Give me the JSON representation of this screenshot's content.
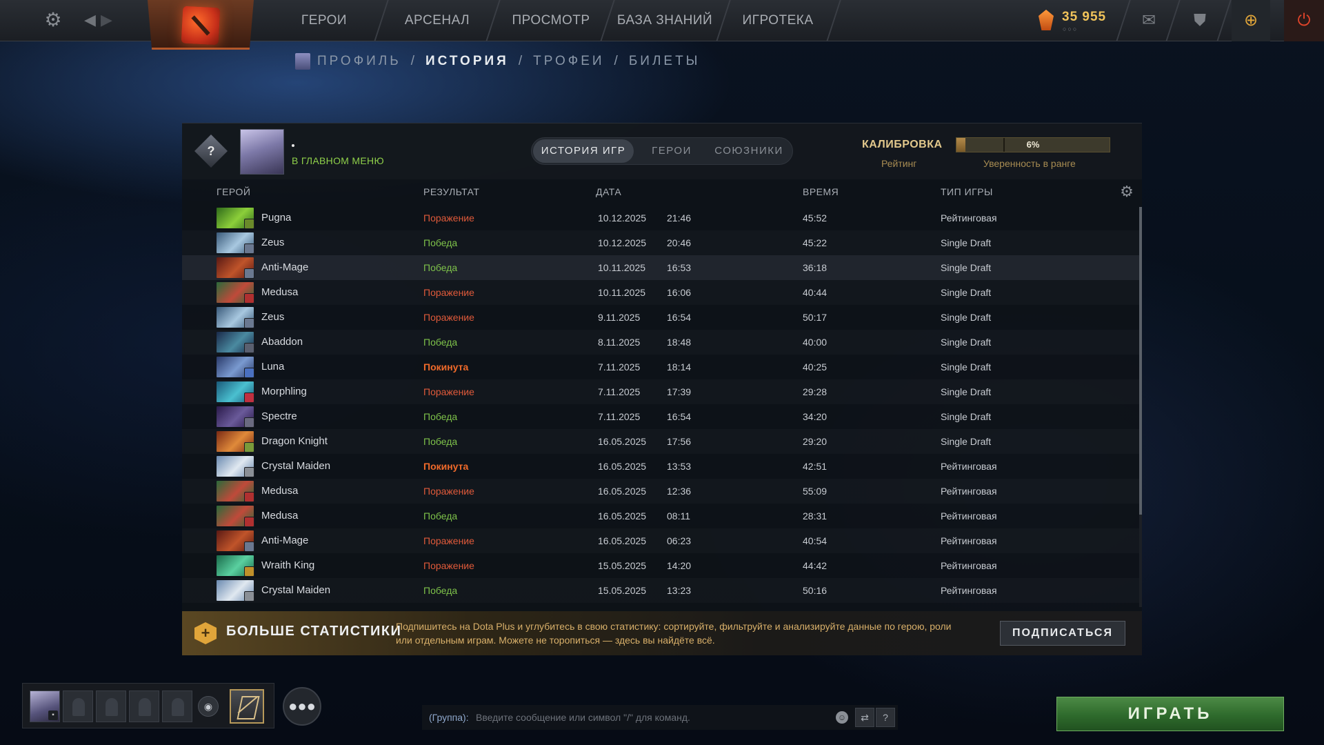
{
  "topbar": {
    "nav": [
      "ГЕРОИ",
      "АРСЕНАЛ",
      "ПРОСМОТР",
      "БАЗА ЗНАНИЙ",
      "ИГРОТЕКА"
    ],
    "shards": "35 955",
    "shards_dots": "○○○"
  },
  "breadcrumb": {
    "items": [
      "ПРОФИЛЬ",
      "ИСТОРИЯ",
      "ТРОФЕИ",
      "БИЛЕТЫ"
    ],
    "separator": "/"
  },
  "profile": {
    "rank_symbol": "?",
    "player_name": "•",
    "status": "В ГЛАВНОМ МЕНЮ"
  },
  "tabs": [
    "ИСТОРИЯ ИГР",
    "ГЕРОИ",
    "СОЮЗНИКИ"
  ],
  "calibration": {
    "title": "КАЛИБРОВКА",
    "rating_label": "Рейтинг",
    "confidence_pct": "6%",
    "confidence_value": 0.06,
    "confidence_label": "Уверенность в ранге"
  },
  "table": {
    "headers": {
      "hero": "ГЕРОЙ",
      "result": "РЕЗУЛЬТАТ",
      "date": "ДАТА",
      "duration": "ВРЕМЯ",
      "type": "ТИП ИГРЫ"
    },
    "rows": [
      {
        "hero": "Pugna",
        "result": "Поражение",
        "result_kind": "loss",
        "date": "10.12.2025",
        "time": "21:46",
        "duration": "45:52",
        "type": "Рейтинговая",
        "colors": [
          "#2f6a1a",
          "#8ccf3a"
        ],
        "badge": "#6a8a2a"
      },
      {
        "hero": "Zeus",
        "result": "Победа",
        "result_kind": "win",
        "date": "10.12.2025",
        "time": "20:46",
        "duration": "45:22",
        "type": "Single Draft",
        "colors": [
          "#3a5a7a",
          "#a8c8e0"
        ],
        "badge": "#6a7890"
      },
      {
        "hero": "Anti-Mage",
        "result": "Победа",
        "result_kind": "win",
        "date": "10.11.2025",
        "time": "16:53",
        "duration": "36:18",
        "type": "Single Draft",
        "colors": [
          "#5a1a14",
          "#c0542a"
        ],
        "badge": "#6a7890"
      },
      {
        "hero": "Medusa",
        "result": "Поражение",
        "result_kind": "loss",
        "date": "10.11.2025",
        "time": "16:06",
        "duration": "40:44",
        "type": "Single Draft",
        "colors": [
          "#2a6a3a",
          "#c04a3a"
        ],
        "badge": "#b03030"
      },
      {
        "hero": "Zeus",
        "result": "Поражение",
        "result_kind": "loss",
        "date": "9.11.2025",
        "time": "16:54",
        "duration": "50:17",
        "type": "Single Draft",
        "colors": [
          "#3a5a7a",
          "#a8c8e0"
        ],
        "badge": "#6a7890"
      },
      {
        "hero": "Abaddon",
        "result": "Победа",
        "result_kind": "win",
        "date": "8.11.2025",
        "time": "18:48",
        "duration": "40:00",
        "type": "Single Draft",
        "colors": [
          "#1a2a4a",
          "#4a8aa0"
        ],
        "badge": "#5a6070"
      },
      {
        "hero": "Luna",
        "result": "Покинута",
        "result_kind": "abandon",
        "date": "7.11.2025",
        "time": "18:14",
        "duration": "40:25",
        "type": "Single Draft",
        "colors": [
          "#2a3a6a",
          "#7a9ad0"
        ],
        "badge": "#4a70c0"
      },
      {
        "hero": "Morphling",
        "result": "Поражение",
        "result_kind": "loss",
        "date": "7.11.2025",
        "time": "17:39",
        "duration": "29:28",
        "type": "Single Draft",
        "colors": [
          "#1a5a7a",
          "#4ac0d0"
        ],
        "badge": "#c03040"
      },
      {
        "hero": "Spectre",
        "result": "Победа",
        "result_kind": "win",
        "date": "7.11.2025",
        "time": "16:54",
        "duration": "34:20",
        "type": "Single Draft",
        "colors": [
          "#2a1a4a",
          "#6a5a9a"
        ],
        "badge": "#6a6a80"
      },
      {
        "hero": "Dragon Knight",
        "result": "Победа",
        "result_kind": "win",
        "date": "16.05.2025",
        "time": "17:56",
        "duration": "29:20",
        "type": "Single Draft",
        "colors": [
          "#7a2a14",
          "#e08a3a"
        ],
        "badge": "#7a9a3a"
      },
      {
        "hero": "Crystal Maiden",
        "result": "Покинута",
        "result_kind": "abandon",
        "date": "16.05.2025",
        "time": "13:53",
        "duration": "42:51",
        "type": "Рейтинговая",
        "colors": [
          "#6a8ab0",
          "#e0e8f0"
        ],
        "badge": "#8a8f96"
      },
      {
        "hero": "Medusa",
        "result": "Поражение",
        "result_kind": "loss",
        "date": "16.05.2025",
        "time": "12:36",
        "duration": "55:09",
        "type": "Рейтинговая",
        "colors": [
          "#2a6a3a",
          "#c04a3a"
        ],
        "badge": "#b03030"
      },
      {
        "hero": "Medusa",
        "result": "Победа",
        "result_kind": "win",
        "date": "16.05.2025",
        "time": "08:11",
        "duration": "28:31",
        "type": "Рейтинговая",
        "colors": [
          "#2a6a3a",
          "#c04a3a"
        ],
        "badge": "#b03030"
      },
      {
        "hero": "Anti-Mage",
        "result": "Поражение",
        "result_kind": "loss",
        "date": "16.05.2025",
        "time": "06:23",
        "duration": "40:54",
        "type": "Рейтинговая",
        "colors": [
          "#5a1a14",
          "#c0542a"
        ],
        "badge": "#6a7890"
      },
      {
        "hero": "Wraith King",
        "result": "Поражение",
        "result_kind": "loss",
        "date": "15.05.2025",
        "time": "14:20",
        "duration": "44:42",
        "type": "Рейтинговая",
        "colors": [
          "#1a6a4a",
          "#5ad0a0"
        ],
        "badge": "#c0902a"
      },
      {
        "hero": "Crystal Maiden",
        "result": "Победа",
        "result_kind": "win",
        "date": "15.05.2025",
        "time": "13:23",
        "duration": "50:16",
        "type": "Рейтинговая",
        "colors": [
          "#6a8ab0",
          "#e0e8f0"
        ],
        "badge": "#8a8f96"
      }
    ],
    "highlighted_row": 2
  },
  "promo": {
    "title": "БОЛЬШЕ СТАТИСТИКИ",
    "text": "Подпишитесь на Dota Plus и углубитесь в свою статистику: сортируйте, фильтруйте и анализируйте данные по герою, роли или отдельным играм. Можете не торопиться — здесь вы найдёте всё.",
    "button": "ПОДПИСАТЬСЯ"
  },
  "chat": {
    "channel": "(Группа):",
    "placeholder": "Введите сообщение или символ \"/\" для команд."
  },
  "play_button": "ИГРАТЬ",
  "colors": {
    "win": "#7ec24a",
    "loss": "#e05a3a",
    "abandon": "#f06a2a",
    "gold": "#e0a53a"
  }
}
